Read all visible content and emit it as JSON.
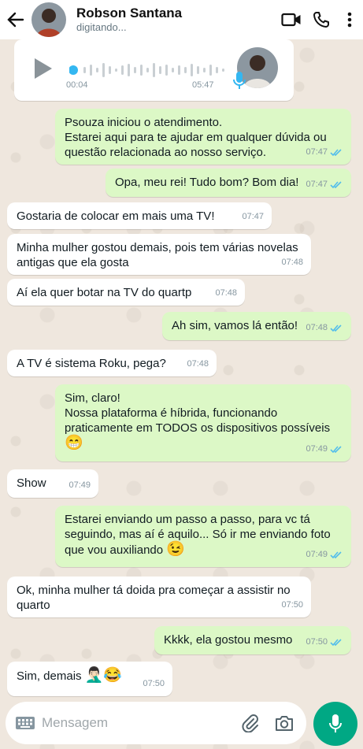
{
  "header": {
    "contact_name": "Robson Santana",
    "status": "digitando..."
  },
  "audio": {
    "current_time": "00:04",
    "duration": "05:47"
  },
  "messages": [
    {
      "dir": "out",
      "text": "Psouza iniciou o atendimento.\nEstarei aqui para te ajudar em qualquer dúvida ou questão relacionada ao nosso serviço.",
      "time": "07:47",
      "read": true
    },
    {
      "dir": "out",
      "text": "Opa, meu rei! Tudo bom? Bom dia!",
      "time": "07:47",
      "read": true
    },
    {
      "dir": "in",
      "text": "Gostaria de colocar em mais uma TV!",
      "time": "07:47"
    },
    {
      "dir": "in",
      "text": "Minha mulher gostou demais, pois tem várias novelas antigas que ela gosta",
      "time": "07:48"
    },
    {
      "dir": "in",
      "text": "Aí ela quer botar na TV do quartp",
      "time": "07:48"
    },
    {
      "dir": "out",
      "text": "Ah sim, vamos lá então!",
      "time": "07:48",
      "read": true
    },
    {
      "dir": "in",
      "text": "A TV é sistema Roku, pega?",
      "time": "07:48"
    },
    {
      "dir": "out",
      "text": "Sim, claro!\nNossa plataforma é híbrida, funcionando praticamente em TODOS os dispositivos possíveis",
      "emoji": "😁",
      "time": "07:49",
      "read": true
    },
    {
      "dir": "in",
      "text": "Show",
      "time": "07:49"
    },
    {
      "dir": "out",
      "text": "Estarei enviando um passo a passo, para vc tá seguindo, mas aí é aquilo... Só ir me enviando foto que vou auxiliando",
      "emoji": "😉",
      "time": "07:49",
      "read": true
    },
    {
      "dir": "in",
      "text": "Ok, minha mulher tá doida pra começar a assistir no quarto",
      "time": "07:50"
    },
    {
      "dir": "out",
      "text": "Kkkk, ela gostou mesmo",
      "time": "07:50",
      "read": true
    },
    {
      "dir": "in",
      "text": "Sim, demais",
      "emoji": "🤦🏻‍♂️😂",
      "time": "07:50"
    }
  ],
  "input": {
    "placeholder": "Mensagem"
  },
  "colors": {
    "outgoing_bubble": "#dcf8c6",
    "incoming_bubble": "#ffffff",
    "accent": "#00a884",
    "read_ticks": "#53bdeb"
  }
}
